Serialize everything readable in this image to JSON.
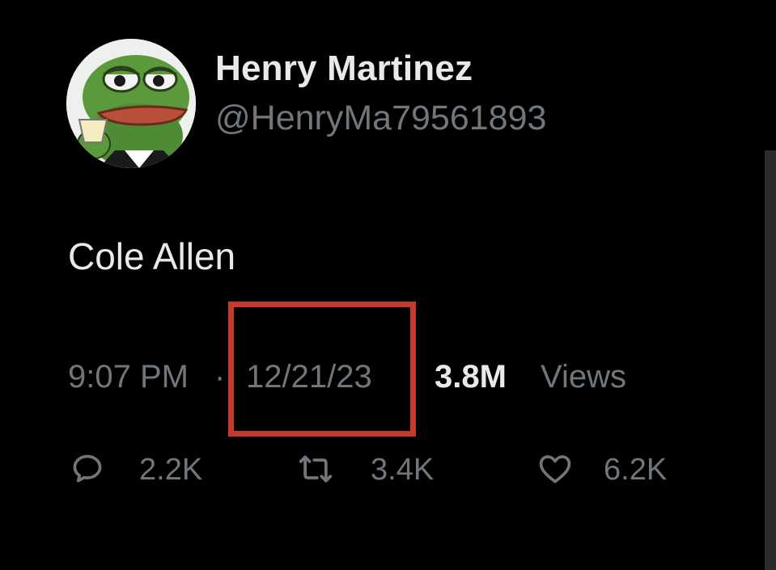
{
  "author": {
    "display_name": "Henry Martinez",
    "handle": "@HenryMa79561893",
    "avatar_icon": "pepe-frog-avatar"
  },
  "tweet": {
    "text": "Cole Allen"
  },
  "meta": {
    "time": "9:07 PM",
    "separator": "·",
    "date": "12/21/23",
    "views_count": "3.8M",
    "views_label": "Views"
  },
  "actions": {
    "replies": "2.2K",
    "retweets": "3.4K",
    "likes": "6.2K"
  },
  "colors": {
    "background": "#000000",
    "primary_text": "#e7e9ea",
    "secondary_text": "#71767b",
    "highlight_box": "#c43b2e"
  }
}
